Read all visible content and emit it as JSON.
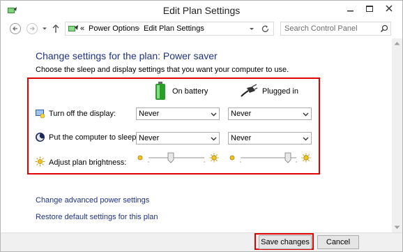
{
  "window": {
    "title": "Edit Plan Settings"
  },
  "navigation": {
    "breadcrumb_prefix": "«",
    "crumbs": [
      "Power Options",
      "Edit Plan Settings"
    ],
    "crumb_separator": "›",
    "search_placeholder": "Search Control Panel"
  },
  "main": {
    "heading": "Change settings for the plan: Power saver",
    "subheading": "Choose the sleep and display settings that you want your computer to use.",
    "columns": {
      "on_battery": "On battery",
      "plugged_in": "Plugged in"
    },
    "rows": {
      "display": {
        "label": "Turn off the display:",
        "battery_value": "Never",
        "plugged_value": "Never"
      },
      "sleep": {
        "label": "Put the computer to sleep:",
        "battery_value": "Never",
        "plugged_value": "Never"
      },
      "brightness": {
        "label": "Adjust plan brightness:",
        "battery_level": 0.4,
        "plugged_level": 0.85
      }
    },
    "links": {
      "advanced": "Change advanced power settings",
      "restore": "Restore default settings for this plan"
    }
  },
  "footer": {
    "save_label": "Save changes",
    "cancel_label": "Cancel"
  },
  "colors": {
    "heading": "#1e3287",
    "highlight": "#e00000",
    "battery_green": "#3bb33b"
  }
}
